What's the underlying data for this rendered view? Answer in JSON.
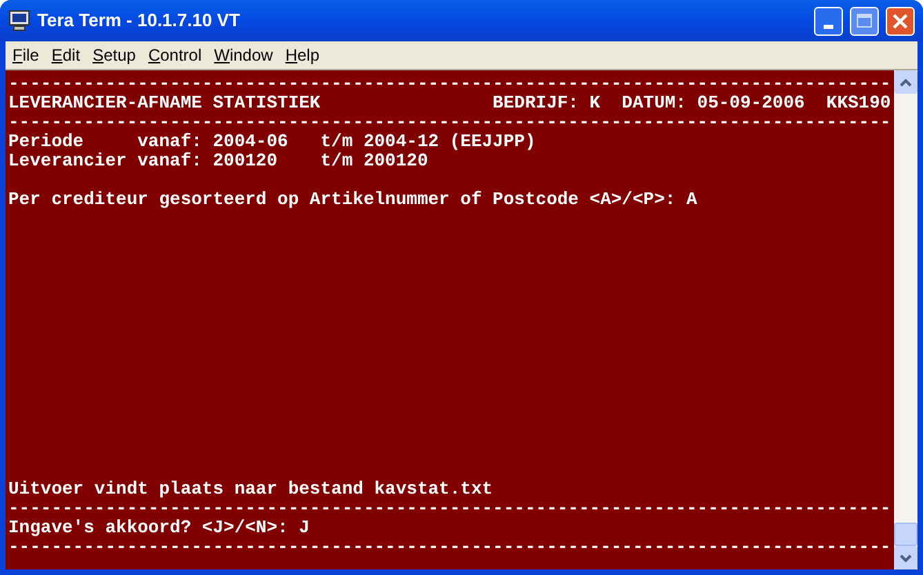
{
  "window": {
    "title": "Tera Term - 10.1.7.10 VT"
  },
  "menu": [
    {
      "label": "File"
    },
    {
      "label": "Edit"
    },
    {
      "label": "Setup"
    },
    {
      "label": "Control"
    },
    {
      "label": "Window"
    },
    {
      "label": "Help"
    }
  ],
  "terminal": {
    "top": [
      "----------------------------------------------------------------------------------",
      "LEVERANCIER-AFNAME STATISTIEK                BEDRIJF: K  DATUM: 05-09-2006  KKS190",
      "----------------------------------------------------------------------------------",
      "Periode     vanaf: 2004-06   t/m 2004-12 (EEJJPP)",
      "Leverancier vanaf: 200120    t/m 200120"
    ],
    "prompt": "Per crediteur gesorteerd op Artikelnummer of Postcode <A>/<P>: A",
    "bottom": [
      "Uitvoer vindt plaats naar bestand kavstat.txt",
      "----------------------------------------------------------------------------------",
      "Ingave's akkoord? <J>/<N>: J",
      "----------------------------------------------------------------------------------"
    ]
  }
}
